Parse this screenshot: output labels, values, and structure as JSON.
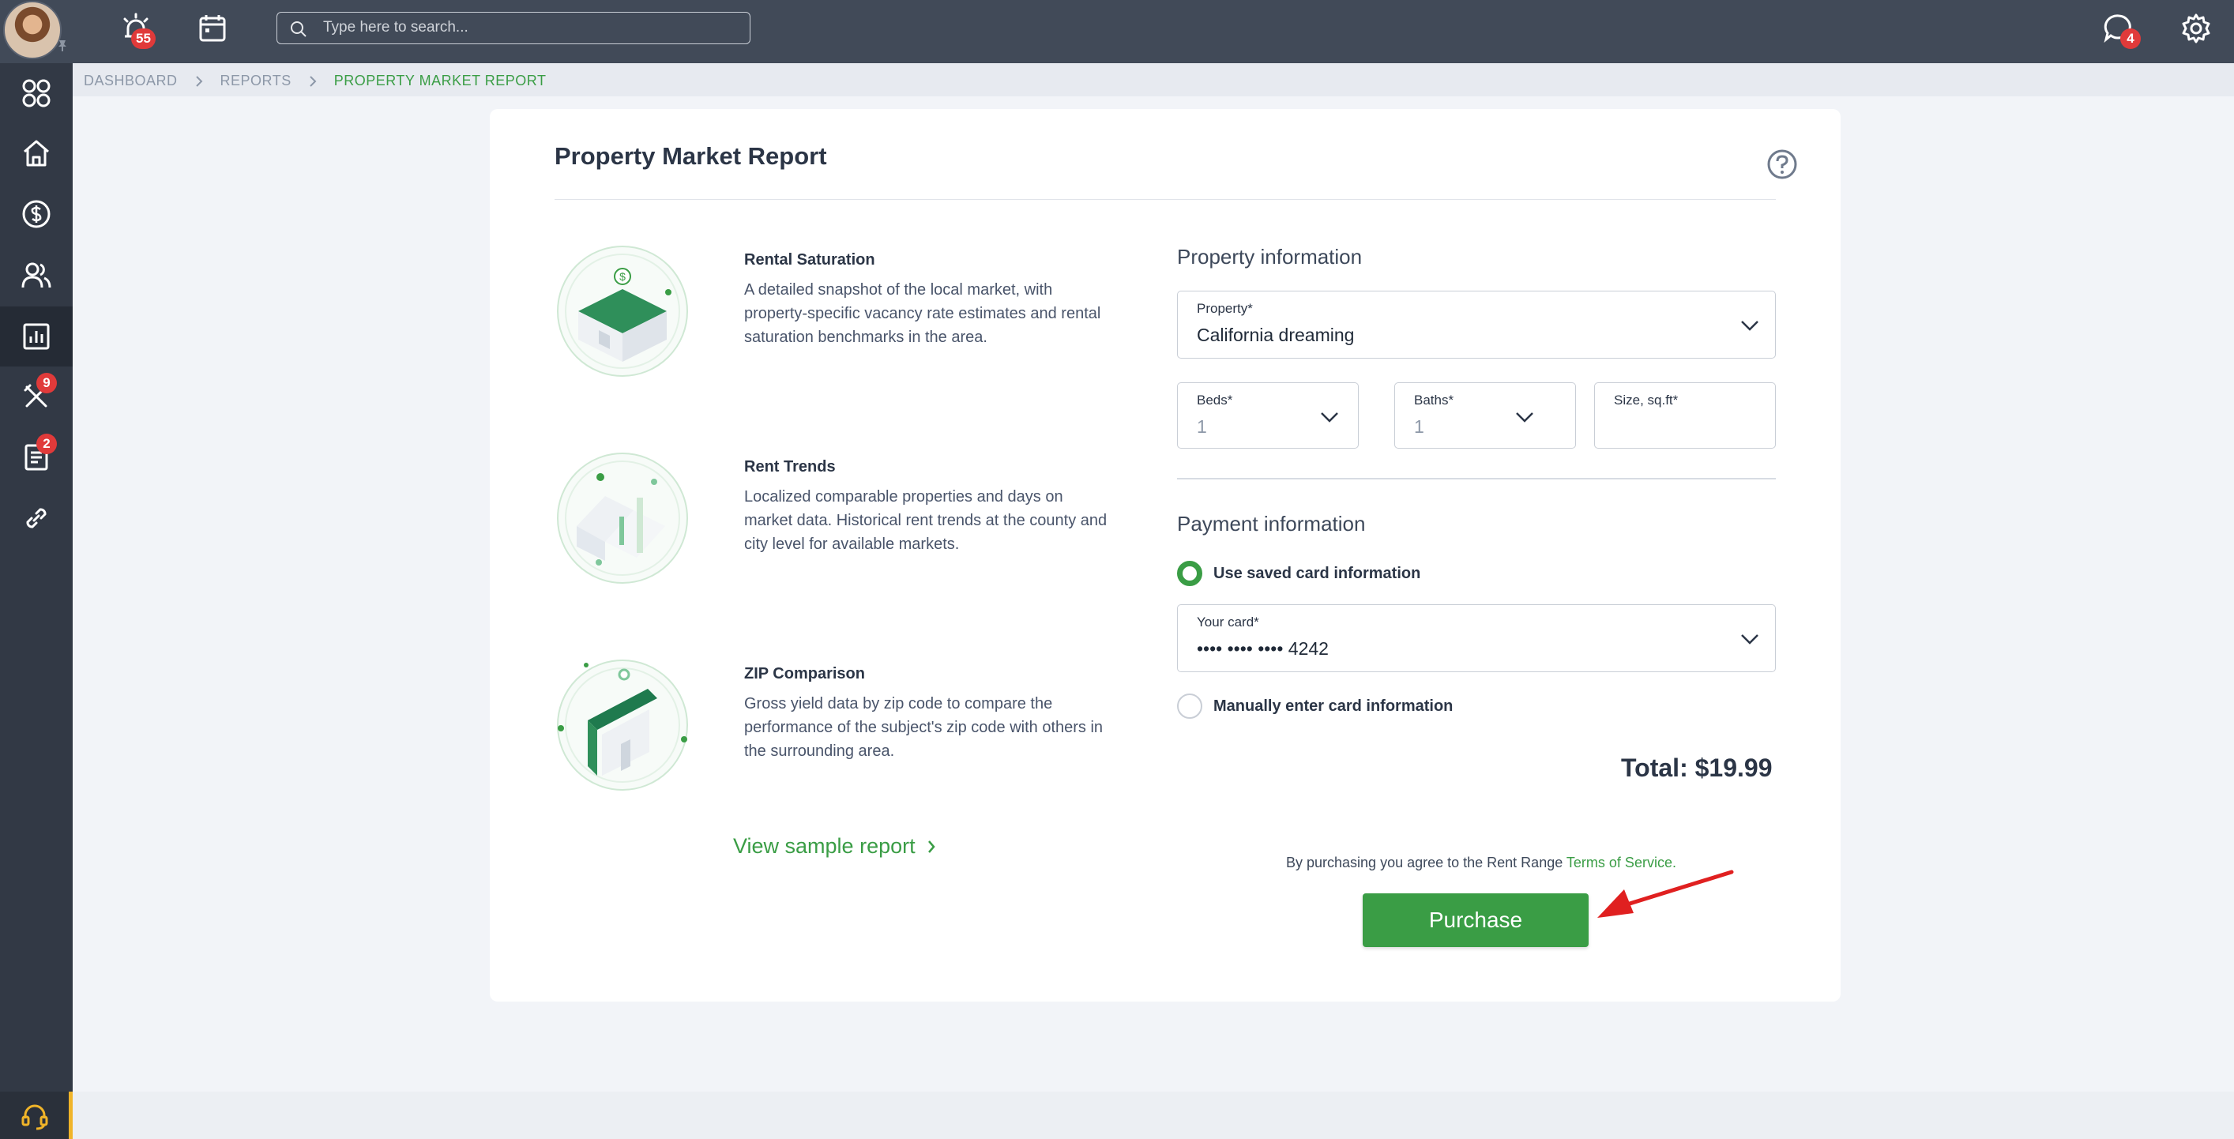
{
  "topbar": {
    "notifications_badge": "55",
    "messages_badge": "4",
    "search": {
      "placeholder": "Type here to search..."
    }
  },
  "sidebar": {
    "items": [
      {
        "icon": "apps-grid-icon"
      },
      {
        "icon": "home-icon"
      },
      {
        "icon": "dollar-icon"
      },
      {
        "icon": "people-icon"
      },
      {
        "icon": "reports-chart-icon",
        "active": true
      },
      {
        "icon": "tools-icon",
        "badge": "9"
      },
      {
        "icon": "document-icon",
        "badge": "2"
      },
      {
        "icon": "link-icon"
      }
    ],
    "support_icon": "headset-icon",
    "accent_color": "#f0b429"
  },
  "breadcrumb": {
    "items": [
      "DASHBOARD",
      "REPORTS",
      "PROPERTY MARKET REPORT"
    ]
  },
  "page": {
    "title": "Property Market Report",
    "features": [
      {
        "title": "Rental Saturation",
        "description": "A detailed snapshot of the local market, with property-specific vacancy rate estimates and rental saturation benchmarks in the area."
      },
      {
        "title": "Rent Trends",
        "description": "Localized comparable properties and days on market data. Historical rent trends at the county and city level for available markets."
      },
      {
        "title": "ZIP Comparison",
        "description": "Gross yield data by zip code to compare the performance of the subject's zip code with others in the surrounding area."
      }
    ],
    "sample_link": "View sample report"
  },
  "form": {
    "property_section": "Property information",
    "property": {
      "label": "Property*",
      "value": "California dreaming"
    },
    "beds": {
      "label": "Beds*",
      "value": "1"
    },
    "baths": {
      "label": "Baths*",
      "value": "1"
    },
    "size": {
      "label": "Size, sq.ft*",
      "value": ""
    },
    "payment_section": "Payment information",
    "use_saved": "Use saved card information",
    "card": {
      "label": "Your card*",
      "value": "•••• •••• •••• 4242"
    },
    "manual": "Manually enter card information",
    "total": "Total: $19.99",
    "agree_text": "By purchasing you agree to the Rent Range",
    "terms_link": "Terms of Service.",
    "purchase_label": "Purchase"
  },
  "colors": {
    "accent_green": "#3a9d45",
    "topbar": "#414a58",
    "sidebar": "#323945",
    "badge_red": "#e03a3a",
    "annotation_arrow": "#e02020"
  }
}
